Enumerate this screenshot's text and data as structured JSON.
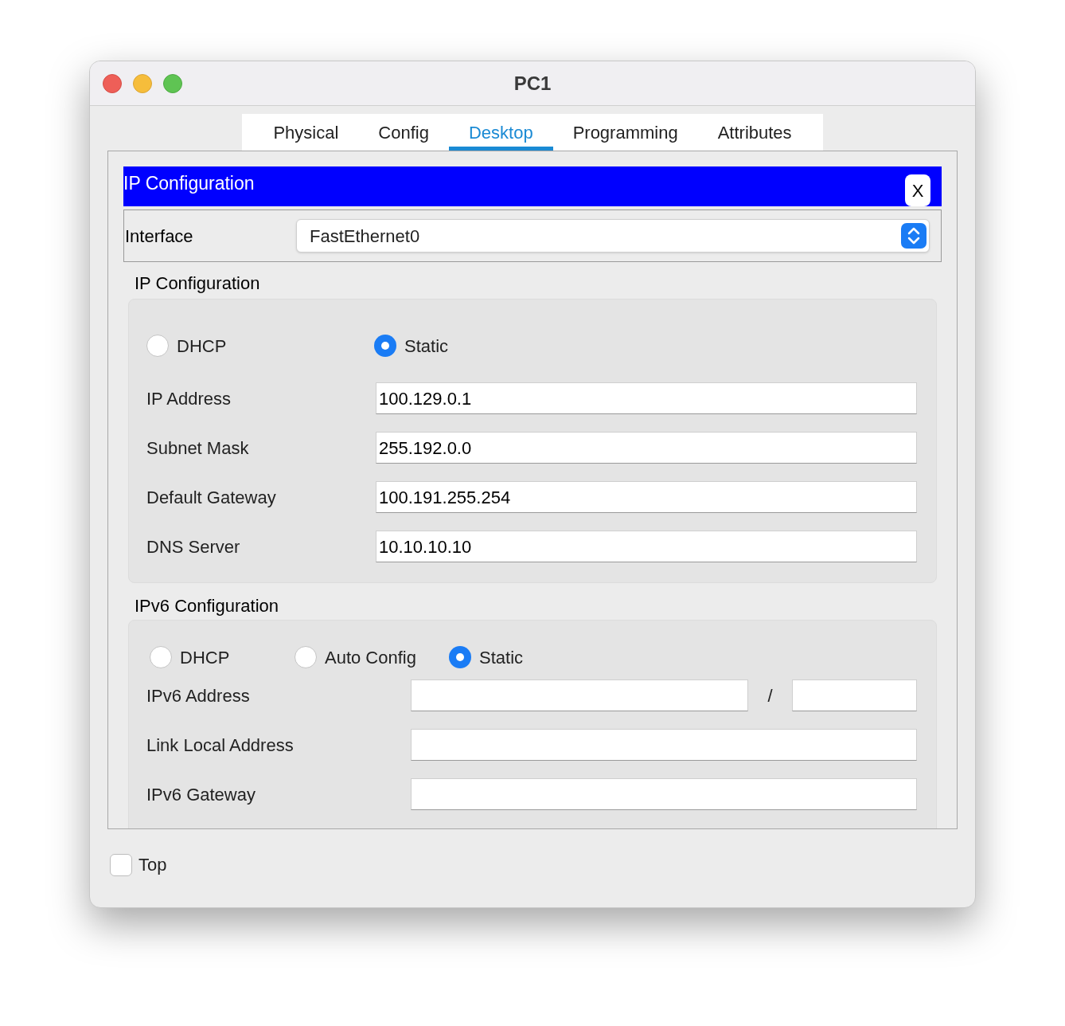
{
  "window": {
    "title": "PC1"
  },
  "tabs": [
    {
      "label": "Physical",
      "selected": false
    },
    {
      "label": "Config",
      "selected": false
    },
    {
      "label": "Desktop",
      "selected": true
    },
    {
      "label": "Programming",
      "selected": false
    },
    {
      "label": "Attributes",
      "selected": false
    }
  ],
  "panel": {
    "title": "IP Configuration",
    "close": "X"
  },
  "interface": {
    "label": "Interface",
    "value": "FastEthernet0"
  },
  "ipv4": {
    "title": "IP Configuration",
    "modes": [
      {
        "label": "DHCP",
        "selected": false
      },
      {
        "label": "Static",
        "selected": true
      }
    ],
    "fields": [
      {
        "kind": "text",
        "label": "IP Address",
        "value": "100.129.0.1"
      },
      {
        "kind": "text",
        "label": "Subnet Mask",
        "value": "255.192.0.0"
      },
      {
        "kind": "text",
        "label": "Default Gateway",
        "value": "100.191.255.254"
      },
      {
        "kind": "text",
        "label": "DNS Server",
        "value": "10.10.10.10"
      }
    ]
  },
  "ipv6": {
    "title": "IPv6 Configuration",
    "modes": [
      {
        "label": "DHCP",
        "selected": false
      },
      {
        "label": "Auto Config",
        "selected": false
      },
      {
        "label": "Static",
        "selected": true
      }
    ],
    "fields": [
      {
        "kind": "prefix",
        "label": "IPv6 Address",
        "separator": "/"
      },
      {
        "kind": "text",
        "label": "Link Local Address"
      },
      {
        "kind": "text",
        "label": "IPv6 Gateway"
      }
    ]
  },
  "top": {
    "label": "Top",
    "checked": false
  }
}
